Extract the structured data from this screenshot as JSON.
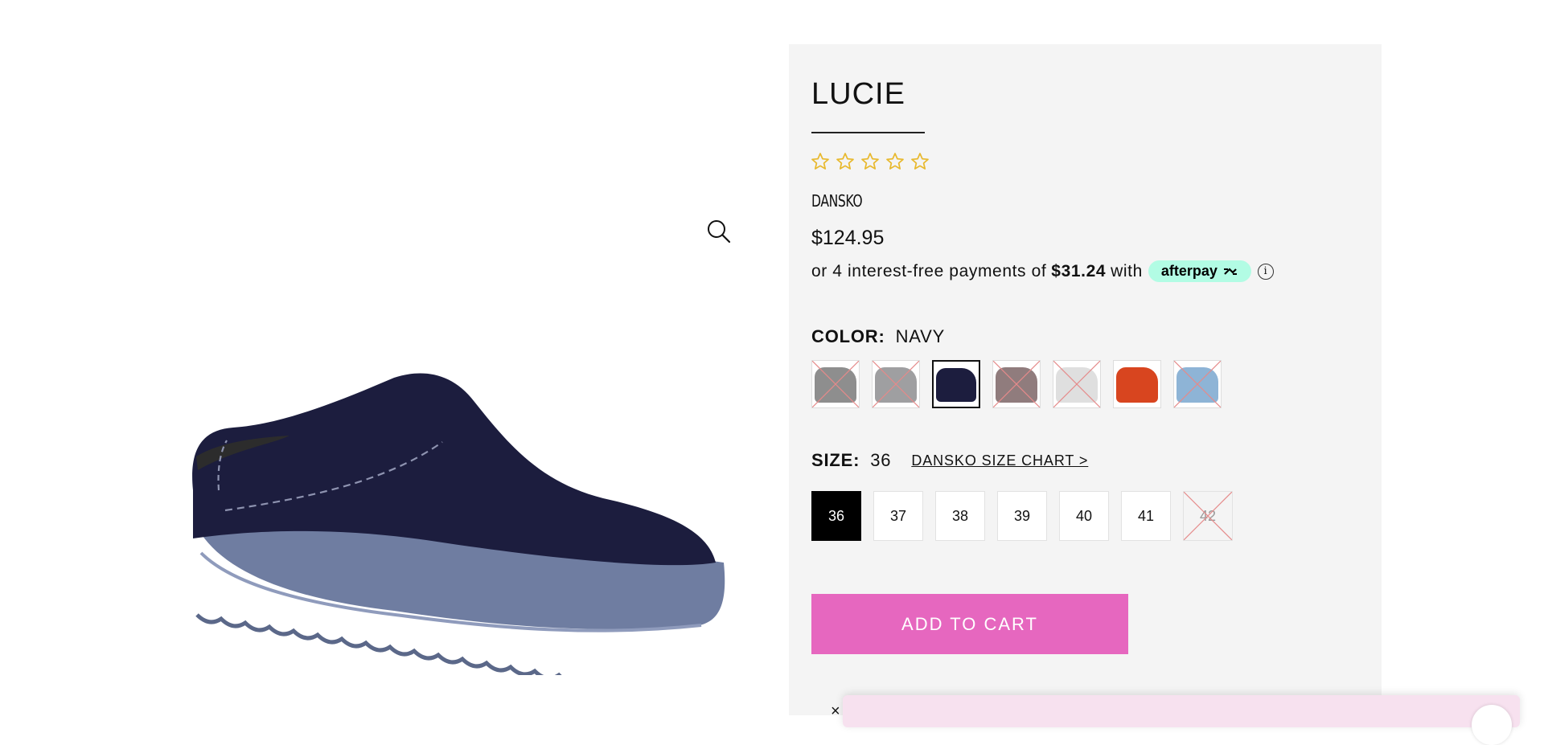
{
  "product": {
    "title": "LUCIE",
    "rating": 0,
    "rating_max": 5,
    "brand": "DANSKO",
    "price": "$124.95"
  },
  "afterpay": {
    "prefix": "or 4 interest-free payments of",
    "amount": "$31.24",
    "suffix": "with",
    "badge": "afterpay",
    "info_icon": "info-icon"
  },
  "color": {
    "label": "COLOR:",
    "selected": "NAVY",
    "swatches": [
      {
        "color": "#7a7a7a",
        "available": false
      },
      {
        "color": "#8e8e90",
        "available": false
      },
      {
        "color": "#1c1d3e",
        "available": true,
        "selected": true
      },
      {
        "color": "#7d6566",
        "available": false
      },
      {
        "color": "#d9d9d9",
        "available": false
      },
      {
        "color": "#d8451f",
        "available": true
      },
      {
        "color": "#7aa7cf",
        "available": false
      }
    ]
  },
  "size": {
    "label": "SIZE:",
    "selected": "36",
    "chart_link": "DANSKO SIZE CHART >",
    "options": [
      {
        "label": "36",
        "selected": true,
        "available": true
      },
      {
        "label": "37",
        "available": true
      },
      {
        "label": "38",
        "available": true
      },
      {
        "label": "39",
        "available": true
      },
      {
        "label": "40",
        "available": true
      },
      {
        "label": "41",
        "available": true
      },
      {
        "label": "42",
        "available": false
      }
    ]
  },
  "cart": {
    "add_label": "ADD TO CART"
  },
  "popup": {
    "close": "×"
  },
  "colors": {
    "accent": "#e667bf",
    "star": "#e8b92e",
    "panel_bg": "#f4f4f4",
    "afterpay_mint": "#b2fce4",
    "shoe_upper": "#1c1d3e",
    "shoe_sole": "#6e7b9e"
  },
  "icons": {
    "zoom": "magnifier-icon",
    "star": "star-outline-icon"
  }
}
